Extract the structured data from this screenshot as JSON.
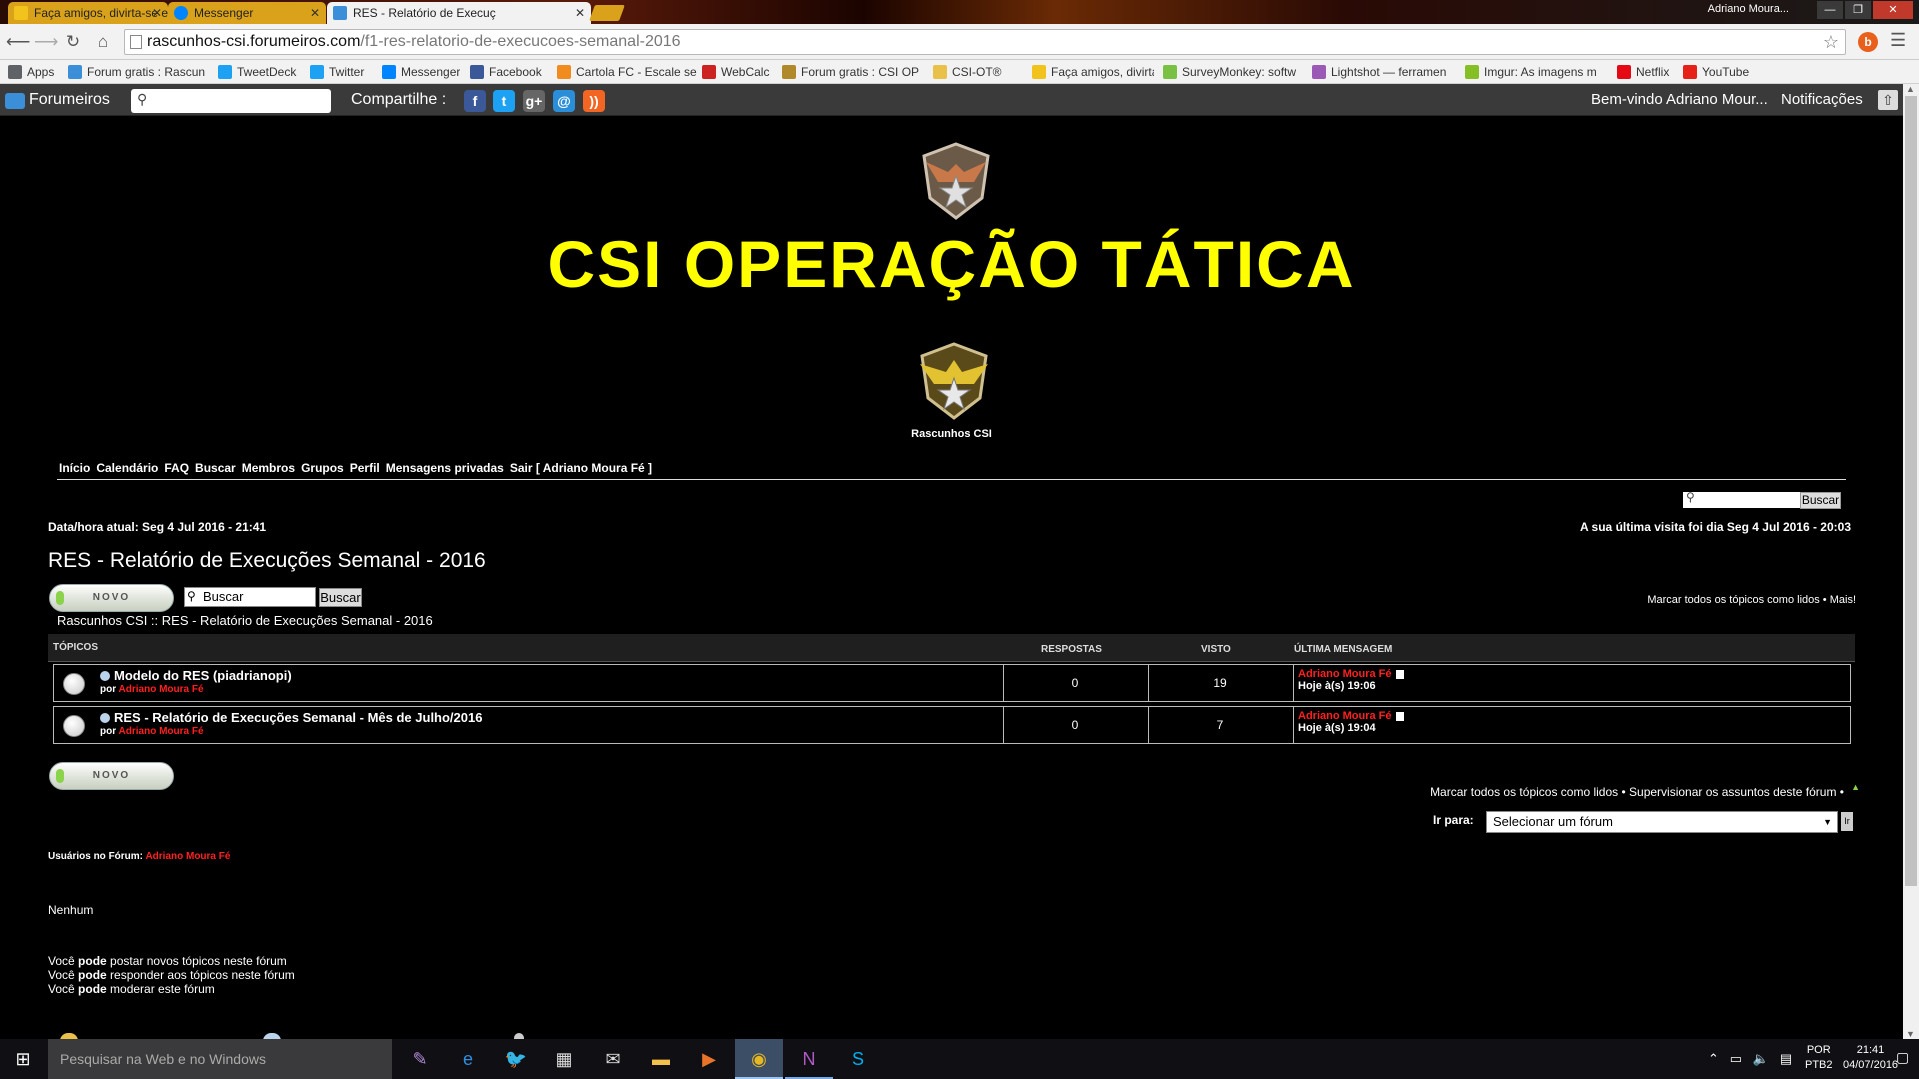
{
  "browser": {
    "tabs": [
      {
        "label": "Faça amigos, divirta-se e c",
        "state": "inactive"
      },
      {
        "label": "Messenger",
        "state": "inactive"
      },
      {
        "label": "RES - Relatório de Execuç",
        "state": "active"
      }
    ],
    "profile_name": "Adriano Moura...",
    "url_host": "rascunhos-csi.forumeiros.com",
    "url_path": "/f1-res-relatorio-de-execucoes-semanal-2016",
    "bookmarks": [
      {
        "label": "Apps",
        "icon": "apps-grid-icon",
        "color": "#5f6368"
      },
      {
        "label": "Forum gratis : Rascun",
        "icon": "forumeiros-icon",
        "color": "#3b8fd8"
      },
      {
        "label": "TweetDeck",
        "icon": "tweetdeck-icon",
        "color": "#1da1f2"
      },
      {
        "label": "Twitter",
        "icon": "twitter-icon",
        "color": "#1da1f2"
      },
      {
        "label": "Messenger",
        "icon": "messenger-icon",
        "color": "#0084ff"
      },
      {
        "label": "Facebook",
        "icon": "facebook-icon",
        "color": "#3b5998"
      },
      {
        "label": "Cartola FC - Escale se",
        "icon": "cartola-icon",
        "color": "#f28b1d"
      },
      {
        "label": "WebCalc",
        "icon": "webcalc-icon",
        "color": "#cc2222"
      },
      {
        "label": "Forum gratis : CSI OP",
        "icon": "forum-emblem-icon",
        "color": "#b08a2a"
      },
      {
        "label": "CSI-OT®",
        "icon": "folder-icon",
        "color": "#e8c04a"
      },
      {
        "label": "Faça amigos, divirta-s",
        "icon": "habbo-icon",
        "color": "#f2c21d"
      },
      {
        "label": "SurveyMonkey: softw",
        "icon": "surveymonkey-icon",
        "color": "#7ac143"
      },
      {
        "label": "Lightshot — ferramen",
        "icon": "lightshot-icon",
        "color": "#9b59b6"
      },
      {
        "label": "Imgur: As imagens m",
        "icon": "imgur-icon",
        "color": "#85bf25"
      },
      {
        "label": "Netflix",
        "icon": "netflix-icon",
        "color": "#e50914"
      },
      {
        "label": "YouTube",
        "icon": "youtube-icon",
        "color": "#e62117"
      }
    ]
  },
  "forumbar": {
    "brand": "Forumeiros",
    "share_label": "Compartilhe :",
    "share_icons": [
      {
        "glyph": "f",
        "name": "facebook-share-icon",
        "color": "#3b5998"
      },
      {
        "glyph": "t",
        "name": "twitter-share-icon",
        "color": "#1da1f2"
      },
      {
        "glyph": "g+",
        "name": "googleplus-share-icon",
        "color": "#666666"
      },
      {
        "glyph": "@",
        "name": "email-share-icon",
        "color": "#2a8fd8"
      },
      {
        "glyph": "))",
        "name": "rss-share-icon",
        "color": "#f26522"
      }
    ],
    "welcome": "Bem-vindo Adriano Mour...",
    "notifications": "Notificações"
  },
  "site": {
    "title": "CSI OPERAÇÃO TÁTICA",
    "subtitle": "Rascunhos CSI",
    "title_color": "#ffff00"
  },
  "nav": {
    "links": [
      "Início",
      "Calendário",
      "FAQ",
      "Buscar",
      "Membros",
      "Grupos",
      "Perfil",
      "Mensagens privadas",
      "Sair [ Adriano Moura Fé ]"
    ]
  },
  "search": {
    "button": "Buscar",
    "topic_placeholder": "Buscar",
    "topic_button": "Buscar"
  },
  "info": {
    "datetime": "Data/hora atual: Seg 4 Jul 2016 - 21:41",
    "last_visit": "A sua última visita foi dia Seg 4 Jul 2016 - 20:03"
  },
  "forum": {
    "title": "RES - Relatório de Execuções Semanal - 2016",
    "new_button": "NOVO",
    "mark_all_top": "Marcar todos os tópicos como lidos • Mais!",
    "breadcrumb": "Rascunhos CSI :: RES - Relatório de Execuções Semanal - 2016",
    "columns": {
      "topics": "TÓPICOS",
      "replies": "RESPOSTAS",
      "views": "VISTO",
      "last": "ÚLTIMA MENSAGEM"
    },
    "topics": [
      {
        "title": "Modelo do RES (piadrianopi)",
        "by_label": "por",
        "author": "Adriano Moura Fé",
        "replies": "0",
        "views": "19",
        "last_author": "Adriano Moura Fé",
        "last_time": "Hoje à(s) 19:06"
      },
      {
        "title": "RES - Relatório de Execuções Semanal - Mês de Julho/2016",
        "by_label": "por",
        "author": "Adriano Moura Fé",
        "replies": "0",
        "views": "7",
        "last_author": "Adriano Moura Fé",
        "last_time": "Hoje à(s) 19:04"
      }
    ],
    "mark_all_bottom": "Marcar todos os tópicos como lidos • Supervisionar os assuntos deste fórum •",
    "jump_label": "Ir para:",
    "jump_value": "Selecionar um fórum",
    "users_label": "Usuários no Fórum:",
    "users_name": "Adriano Moura Fé",
    "none": "Nenhum",
    "permissions": [
      {
        "pre": "Você ",
        "bold": "pode",
        "post": " postar novos tópicos neste fórum"
      },
      {
        "pre": "Você ",
        "bold": "pode",
        "post": " responder aos tópicos neste fórum"
      },
      {
        "pre": "Você ",
        "bold": "pode",
        "post": " moderar este fórum"
      }
    ]
  },
  "taskbar": {
    "search_placeholder": "Pesquisar na Web e no Windows",
    "apps": [
      {
        "name": "feather-app-icon",
        "glyph": "✎",
        "color": "#b38cd9",
        "state": ""
      },
      {
        "name": "edge-icon",
        "glyph": "e",
        "color": "#2f8fe0",
        "state": ""
      },
      {
        "name": "twitter-app-icon",
        "glyph": "🐦",
        "color": "#1da1f2",
        "state": ""
      },
      {
        "name": "calculator-icon",
        "glyph": "▦",
        "color": "#dddddd",
        "state": ""
      },
      {
        "name": "mail-icon",
        "glyph": "✉",
        "color": "#dddddd",
        "state": ""
      },
      {
        "name": "file-explorer-icon",
        "glyph": "▬",
        "color": "#f2c24a",
        "state": ""
      },
      {
        "name": "media-player-icon",
        "glyph": "▶",
        "color": "#e8742a",
        "state": ""
      },
      {
        "name": "chrome-icon",
        "glyph": "◉",
        "color": "#e8b820",
        "state": "active"
      },
      {
        "name": "onenote-icon",
        "glyph": "N",
        "color": "#b05ac4",
        "state": "running"
      },
      {
        "name": "skype-icon",
        "glyph": "S",
        "color": "#00aff0",
        "state": ""
      }
    ],
    "lang": "POR",
    "lang2": "PTB2",
    "time": "21:41",
    "date": "04/07/2016"
  }
}
